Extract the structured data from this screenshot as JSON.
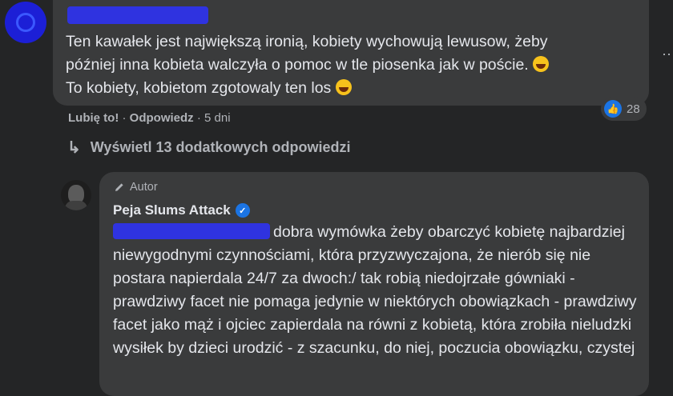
{
  "comment": {
    "text_line1": "Ten kawałek jest największą ironią, kobiety wychowują lewusow, żeby",
    "text_line2": "później inna kobieta walczyła o pomoc w tle piosenka jak w poście.",
    "text_line3": "To kobiety, kobietom zgotowaly ten los",
    "like_label": "Lubię to!",
    "separator": "·",
    "reply_label": "Odpowiedz",
    "time": "5 dni",
    "reaction_count": "28"
  },
  "more_replies": {
    "label": "Wyświetl 13 dodatkowych odpowiedzi"
  },
  "reply": {
    "badge": "Autor",
    "author": "Peja Slums Attack",
    "text": "dobra wymówka żeby obarczyć kobietę najbardziej niewygodnymi czynnościami, która przyzwyczajona, że nierób się nie postara napierdala 24/7 za dwoch:/ tak robią niedojrzałe gówniaki - prawdziwy facet nie pomaga jedynie w niektórych obowiązkach - prawdziwy facet jako mąż i ojciec zapierdala na równi z kobietą, która zrobiła nieludzki wysiłek by dzieci urodzić - z szacunku, do niej, poczucia obowiązku, czystej"
  },
  "icons": {
    "emoji": "grinning-sweat-emoji",
    "like": "thumbs-up-icon",
    "reply_arrow": "reply-arrow-icon",
    "badge": "pencil-icon",
    "verified": "verified-check-icon"
  },
  "colors": {
    "background": "#242526",
    "bubble": "#3a3b3c",
    "text": "#e4e6eb",
    "muted": "#b0b3b8",
    "accent": "#1b74e4"
  }
}
